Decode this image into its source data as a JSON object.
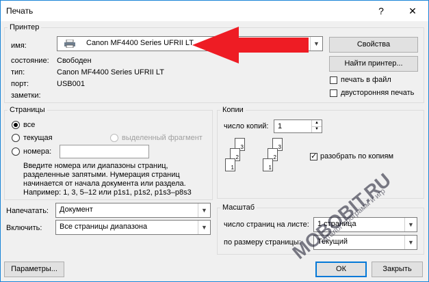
{
  "window": {
    "title": "Печать",
    "help_label": "?",
    "close_label": "✕"
  },
  "printer": {
    "group_label": "Принтер",
    "name_label": "имя:",
    "name_value": "Canon MF4400 Series UFRII LT",
    "status_label": "состояние:",
    "status_value": "Свободен",
    "type_label": "тип:",
    "type_value": "Canon MF4400 Series UFRII LT",
    "port_label": "порт:",
    "port_value": "USB001",
    "notes_label": "заметки:",
    "properties_button": "Свойства",
    "find_printer_button": "Найти принтер...",
    "print_to_file_label": "печать в файл",
    "print_to_file_checked": false,
    "duplex_label": "двусторонняя печать",
    "duplex_checked": false,
    "arrow_color": "#ee1c24"
  },
  "pages": {
    "group_label": "Страницы",
    "all_label": "все",
    "current_label": "текущая",
    "selection_label": "выделенный фрагмент",
    "numbers_label": "номера:",
    "numbers_value": "",
    "selected": "all",
    "hint_line1": "Введите номера или диапазоны страниц,",
    "hint_line2": "разделенные запятыми. Нумерация страниц",
    "hint_line3": "начинается от начала документа или раздела.",
    "hint_line4": "Например: 1, 3, 5–12 или p1s1, p1s2, p1s3–p8s3"
  },
  "copies": {
    "group_label": "Копии",
    "count_label": "число копий:",
    "count_value": "1",
    "collate_label": "разобрать по копиям",
    "collate_checked": true,
    "sheet_numbers": [
      "1",
      "2",
      "3"
    ]
  },
  "print_what": {
    "label": "Напечатать:",
    "value": "Документ"
  },
  "include": {
    "label": "Включить:",
    "value": "Все страницы диапазона"
  },
  "zoom": {
    "group_label": "Масштаб",
    "pages_per_sheet_label": "число страниц на листе:",
    "pages_per_sheet_value": "1 страница",
    "scale_label": "по размеру страницы:",
    "scale_value": "Текущий"
  },
  "buttons": {
    "options": "Параметры...",
    "ok": "ОК",
    "close": "Закрыть"
  },
  "watermark": {
    "brand": "MOBOBIT.RU",
    "tagline": "каталог программ и игр"
  }
}
